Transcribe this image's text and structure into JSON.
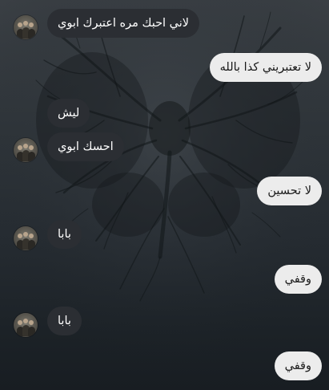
{
  "messages": [
    {
      "side": "in",
      "text": "لاني احبك مره اعتبرك ابوي",
      "avatar": true
    },
    {
      "side": "out",
      "text": "لا تعتبريني كذا بالله"
    },
    {
      "side": "in",
      "text": "ليش",
      "avatar": false
    },
    {
      "side": "in",
      "text": "احسك ابوي",
      "avatar": true
    },
    {
      "side": "out",
      "text": "لا تحسين"
    },
    {
      "side": "in",
      "text": "بابا",
      "avatar": true
    },
    {
      "side": "out",
      "text": "وقفي"
    },
    {
      "side": "in",
      "text": "بابا",
      "avatar": true
    },
    {
      "side": "out",
      "text": "وقفي"
    }
  ],
  "icons": {
    "avatar": "profile-photo-group",
    "wallpaper": "dark-tree-butterfly"
  },
  "colors": {
    "incoming_bubble": "#2b2e33",
    "outgoing_bubble": "#ececec",
    "background": "#262c32"
  }
}
